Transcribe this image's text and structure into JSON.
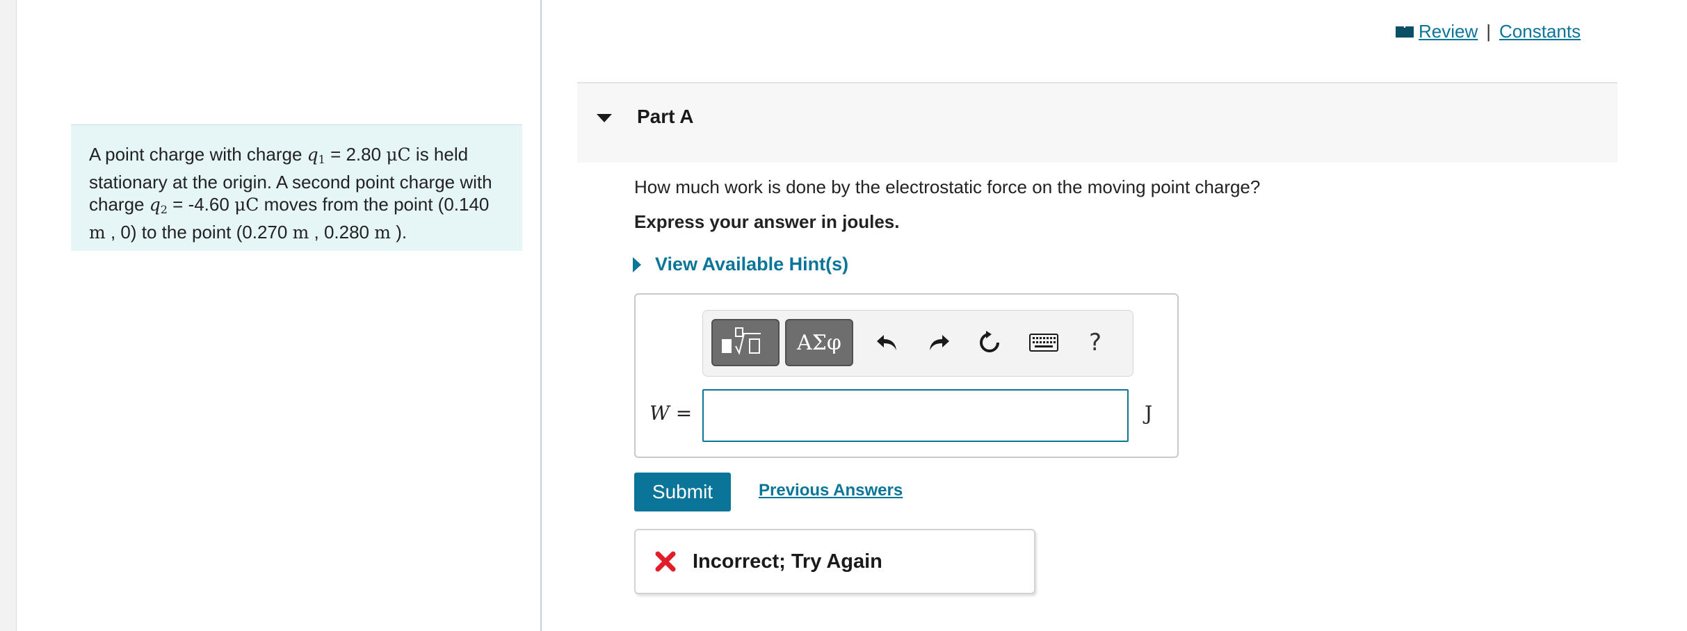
{
  "top_links": {
    "review": "Review",
    "separator": "|",
    "constants": "Constants"
  },
  "problem": {
    "t1": "A point charge with charge ",
    "q1_var": "q",
    "q1_sub": "1",
    "t2": " = 2.80 ",
    "unit_uC": "μC",
    "t3": " is held stationary at the origin. A second point charge with charge ",
    "q2_var": "q",
    "q2_sub": "2",
    "t4": " = -4.60 ",
    "t5": " moves from the point (0.140 ",
    "unit_m": "m",
    "t6": " , 0) to the point (0.270 ",
    "t7": " , 0.280 ",
    "t8": " )."
  },
  "part": {
    "title": "Part A",
    "question": "How much work is done by the electrostatic force on the moving point charge?",
    "instruction": "Express your answer in joules.",
    "hint_label": "View Available Hint(s)"
  },
  "answer": {
    "variable": "W",
    "equals": "=",
    "unit": "J",
    "value": "",
    "toolbar": {
      "greek_label": "ΑΣφ",
      "help_label": "?",
      "icons": [
        "templates-icon",
        "undo-icon",
        "redo-icon",
        "reset-icon",
        "keyboard-icon",
        "help-icon"
      ]
    }
  },
  "actions": {
    "submit_label": "Submit",
    "previous_answers_label": "Previous Answers"
  },
  "feedback": {
    "message": "Incorrect; Try Again",
    "status_color": "#e11d2a"
  },
  "colors": {
    "accent": "#0b7599",
    "problem_bg": "#e6f5f6"
  }
}
